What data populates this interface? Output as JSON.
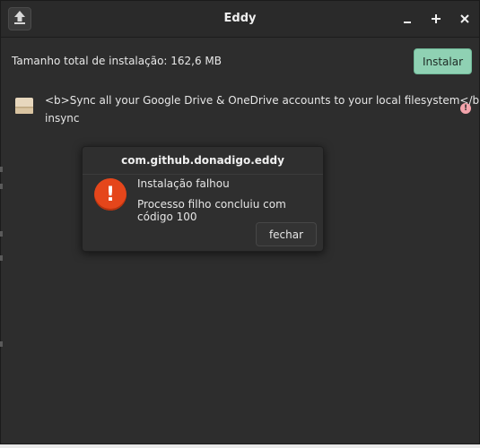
{
  "window": {
    "title": "Eddy",
    "controls": {
      "minimize": "–",
      "maximize": "+",
      "close": "×"
    }
  },
  "header": {
    "upload_icon": "upload-icon"
  },
  "summary": {
    "size_label": "Tamanho total de instalação: 162,6 MB",
    "install_button": "Instalar"
  },
  "package": {
    "icon": "package-icon",
    "description": "<b>Sync all your Google Drive & OneDrive accounts to your local filesystem</b>",
    "name": "insync",
    "status_icon": "warning-icon"
  },
  "dialog": {
    "title": "com.github.donadigo.eddy",
    "error_icon": "error-icon",
    "error_title": "Instalação falhou",
    "error_message": "Processo filho concluiu com código 100",
    "close_button": "fechar"
  },
  "colors": {
    "window_bg": "#2d2d2d",
    "accent_install": "#8fd1b3",
    "error_red": "#e5461b",
    "warning_pink": "#f2a3ab"
  }
}
